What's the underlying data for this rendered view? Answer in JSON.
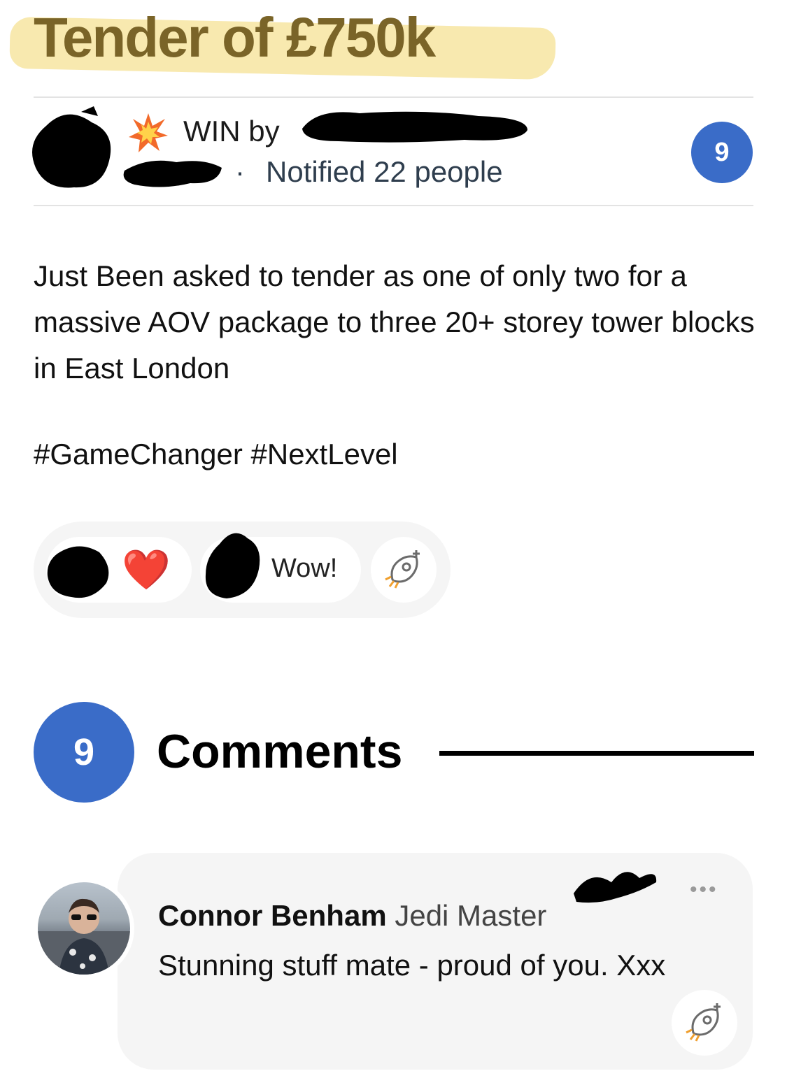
{
  "post": {
    "title": "Tender of £750k",
    "win_label": "WIN by",
    "separator": "·",
    "notified": "Notified 22 people",
    "comment_count": "9",
    "body": "Just Been asked to tender as one of only two for a massive AOV package to three 20+ storey tower blocks in East London",
    "hashtags": "#GameChanger #NextLevel"
  },
  "reactions": {
    "heart_emoji": "❤️",
    "wow_label": "Wow!"
  },
  "comments": {
    "count": "9",
    "title": "Comments",
    "items": [
      {
        "author": "Connor Benham",
        "rank": "Jedi Master",
        "text": "Stunning stuff mate - proud of you. Xxx",
        "more": "•••"
      }
    ]
  },
  "colors": {
    "accent_blue": "#3a6cc8",
    "title_highlight": "#f7e7a6",
    "title_text": "#7a6428",
    "card_bg": "#f5f5f5"
  }
}
